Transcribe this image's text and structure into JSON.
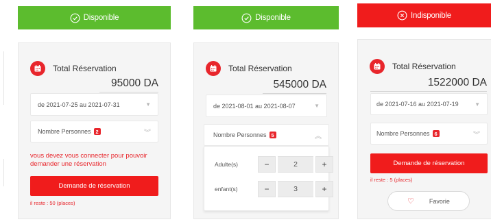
{
  "colors": {
    "available": "#5cbc2e",
    "unavailable": "#f01c1c",
    "accent": "#e8262c"
  },
  "cards": [
    {
      "status": "Disponible",
      "status_icon": "check-circle-icon",
      "title": "Total Réservation",
      "price": "95000 DA",
      "date_range": "de 2021-07-25 au 2021-07-31",
      "persons_label": "Nombre Personnes",
      "persons_count": "2",
      "login_message": "vous devez vous connecter pour pouvoir demander une réservation",
      "request_button": "Demande de réservation",
      "remaining": "il reste : 50 (places)"
    },
    {
      "status": "Disponible",
      "status_icon": "check-circle-icon",
      "title": "Total Réservation",
      "price": "545000 DA",
      "date_range": "de 2021-08-01 au 2021-08-07",
      "persons_label": "Nombre Personnes",
      "persons_count": "5",
      "adults_label": "Adulte(s)",
      "adults_value": "2",
      "children_label": "enfant(s)",
      "children_value": "3",
      "minus": "−",
      "plus": "+"
    },
    {
      "status": "Indisponible",
      "status_icon": "x-circle-icon",
      "title": "Total Réservation",
      "price": "1522000 DA",
      "date_range": "de 2021-07-16 au 2021-07-19",
      "persons_label": "Nombre Personnes",
      "persons_count": "6",
      "request_button": "Demande de réservation",
      "remaining": "il reste : 5 (places)",
      "favorite": "Favorie"
    }
  ]
}
